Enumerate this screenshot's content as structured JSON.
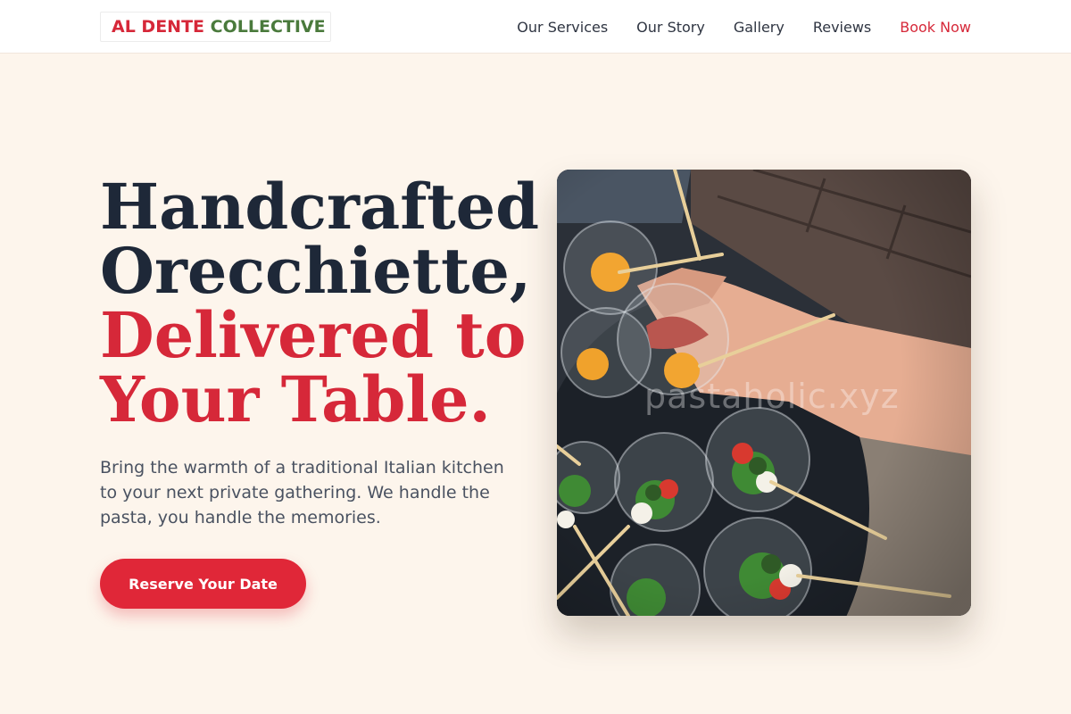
{
  "brand": {
    "part1": "AL DENTE",
    "part2": "COLLECTIVE"
  },
  "nav": {
    "items": [
      {
        "label": "Our Services"
      },
      {
        "label": "Our Story"
      },
      {
        "label": "Gallery"
      },
      {
        "label": "Reviews"
      },
      {
        "label": "Book Now"
      }
    ]
  },
  "hero": {
    "headline": {
      "line1": "Handcrafted",
      "line2": "Orecchiette,",
      "line3": "Delivered to",
      "line4": "Your Table."
    },
    "subtext": "Bring the warmth of a traditional Italian kitchen to your next private gathering. We handle the pasta, you handle the memories.",
    "cta_label": "Reserve Your Date",
    "image": {
      "watermark": "pastaholic.xyz",
      "icon": "food-appetizers-photo"
    }
  },
  "colors": {
    "accent": "#d62839",
    "brand_green": "#4a7a3c",
    "background": "#fdf5ec",
    "heading": "#1e2838",
    "body_text": "#4a5261"
  }
}
